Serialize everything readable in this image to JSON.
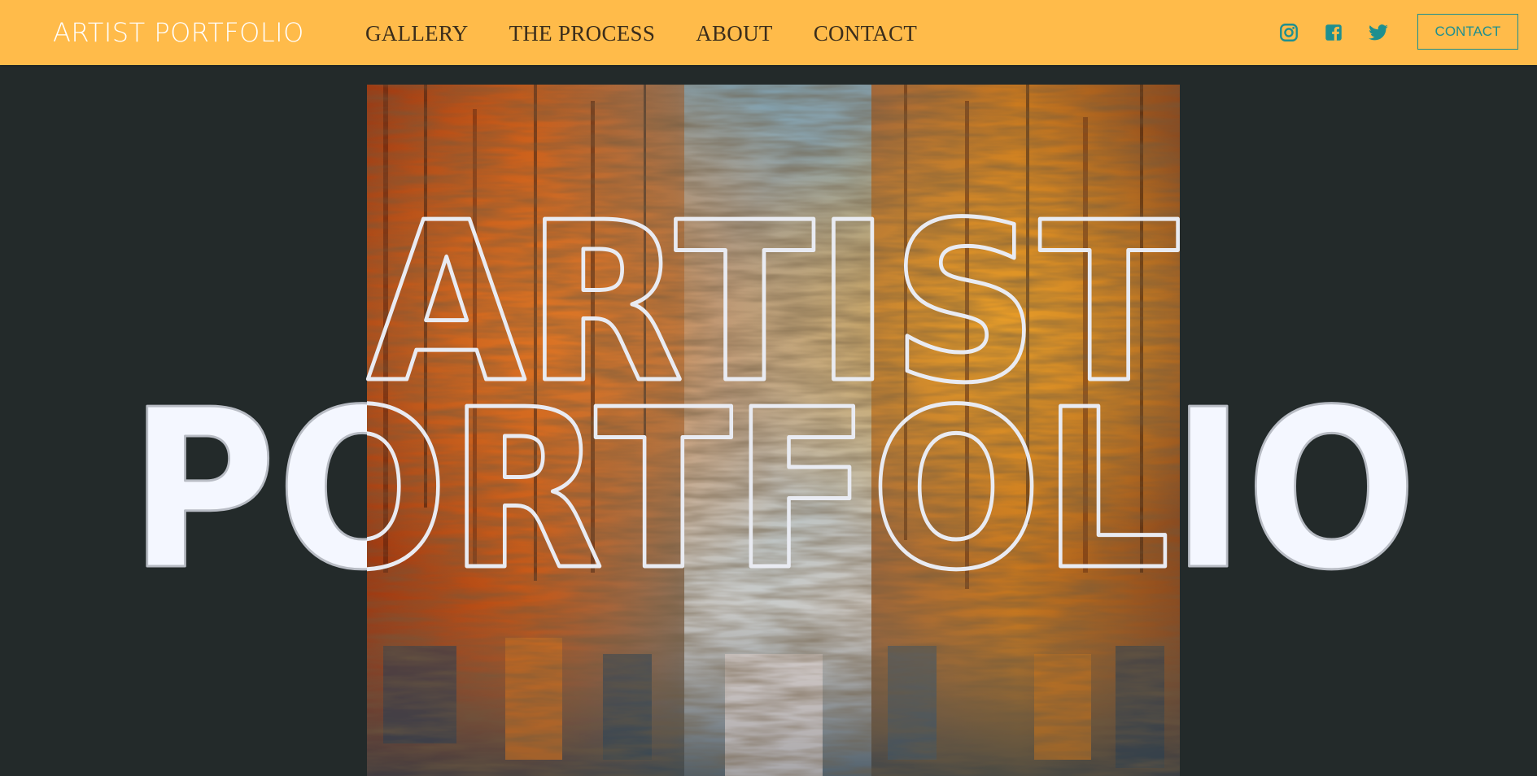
{
  "header": {
    "brand": "ARTIST PORTFOLIO",
    "nav": [
      "GALLERY",
      "THE PROCESS",
      "ABOUT",
      "CONTACT"
    ],
    "social_icons": [
      "instagram-icon",
      "facebook-icon",
      "twitter-icon"
    ],
    "contact_button": "CONTACT"
  },
  "hero": {
    "line1": "ARTIST",
    "line2": "PORTFOLIO",
    "painting_subject": "abstract painting of autumn trees reflected in water"
  },
  "colors": {
    "header_bg": "#ffbb4a",
    "page_bg": "#232a2a",
    "accent": "#1e8f8f",
    "nav_text": "#3b2d1b",
    "hero_fill": "#f4f7ff",
    "hero_outline": "#e9ebf2"
  }
}
